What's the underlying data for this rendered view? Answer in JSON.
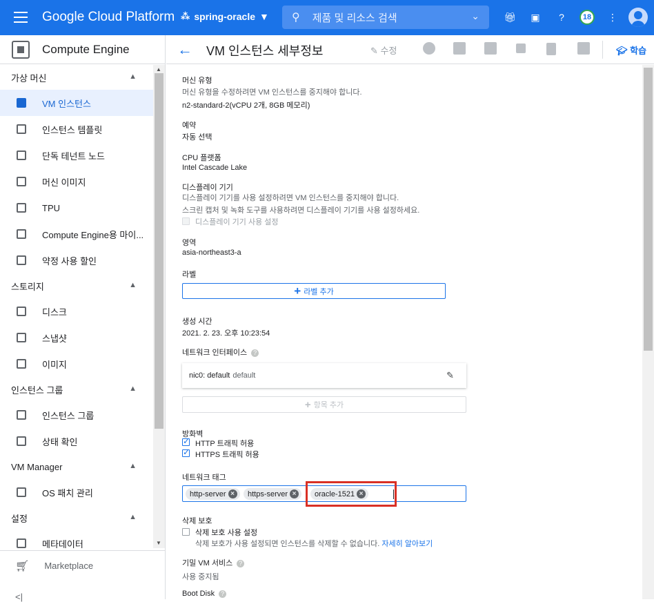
{
  "topbar": {
    "brand": "Google Cloud Platform",
    "project": "spring-oracle",
    "search_placeholder": "제품 및 리소스 검색",
    "notification_count": "18"
  },
  "sidebar": {
    "product_title": "Compute Engine",
    "sections": [
      {
        "title": "가상 머신",
        "items": [
          "VM 인스턴스",
          "인스턴스 템플릿",
          "단독 테넌트 노드",
          "머신 이미지",
          "TPU",
          "Compute Engine용 마이...",
          "약정 사용 할인"
        ]
      },
      {
        "title": "스토리지",
        "items": [
          "디스크",
          "스냅샷",
          "이미지"
        ]
      },
      {
        "title": "인스턴스 그룹",
        "items": [
          "인스턴스 그룹",
          "상태 확인"
        ]
      },
      {
        "title": "VM Manager",
        "items": [
          "OS 패치 관리"
        ]
      },
      {
        "title": "설정",
        "items": [
          "메타데이터"
        ]
      }
    ],
    "marketplace": "Marketplace",
    "collapse": "<|"
  },
  "header": {
    "title": "VM 인스턴스 세부정보",
    "edit_label": "수정",
    "learn_label": "학습"
  },
  "details": {
    "machine_type_label": "머신 유형",
    "machine_type_note": "머신 유형을 수정하려면 VM 인스턴스를 중지해야 합니다.",
    "machine_type_value": "n2-standard-2(vCPU 2개, 8GB 메모리)",
    "reservation_label": "예약",
    "reservation_value": "자동 선택",
    "cpu_platform_label": "CPU 플랫폼",
    "cpu_platform_value": "Intel Cascade Lake",
    "display_label": "디스플레이 기기",
    "display_note1": "디스플레이 기기를 사용 설정하려면 VM 인스턴스를 중지해야 합니다.",
    "display_note2": "스크린 캡처 및 녹화 도구를 사용하려면 디스플레이 기기를 사용 설정하세요.",
    "display_checkbox": "디스플레이 기기 사용 설정",
    "zone_label": "영역",
    "zone_value": "asia-northeast3-a",
    "labels_label": "라벨",
    "add_label_button": "라벨 추가",
    "created_label": "생성 시간",
    "created_value": "2021. 2. 23. 오후 10:23:54",
    "nic_label": "네트워크 인터페이스",
    "nic_name": "nic0: default",
    "nic_network": "default",
    "add_item_button": "항목 추가",
    "firewall_label": "방화벽",
    "http_label": "HTTP 트래픽 허용",
    "https_label": "HTTPS 트래픽 허용",
    "net_tags_label": "네트워크 태그",
    "tags": [
      "http-server",
      "https-server",
      "oracle-1521"
    ],
    "deletion_label": "삭제 보호",
    "deletion_checkbox": "삭제 보호 사용 설정",
    "deletion_note": "삭제 보호가 사용 설정되면 인스턴스를 삭제할 수 없습니다.",
    "learn_more": "자세히 알아보기",
    "confidential_label": "기밀 VM 서비스",
    "confidential_value": "사용 중지됨",
    "boot_disk_label": "Boot Disk"
  },
  "colors": {
    "topbar": "#1a73e8",
    "accent": "#1a73e8",
    "highlight_box": "#d93025"
  }
}
